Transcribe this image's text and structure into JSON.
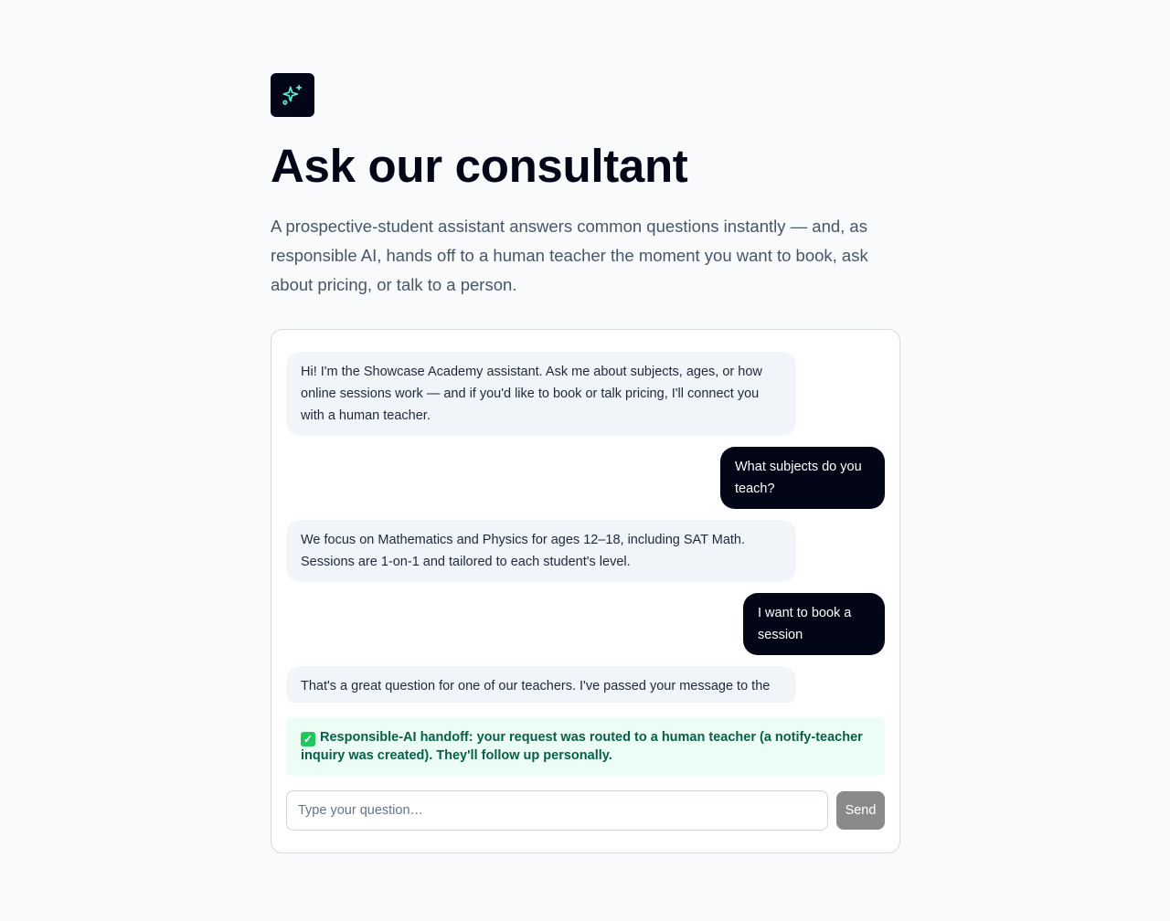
{
  "header": {
    "logo_icon": "sparkles-icon",
    "title": "Ask our consultant",
    "subtitle": "A prospective-student assistant answers common questions instantly — and, as responsible AI, hands off to a human teacher the moment you want to book, ask about pricing, or talk to a person."
  },
  "chat": {
    "messages": [
      {
        "role": "assistant",
        "text": "Hi! I'm the Showcase Academy assistant. Ask me about subjects, ages, or how online sessions work — and if you'd like to book or talk pricing, I'll connect you with a human teacher."
      },
      {
        "role": "user",
        "text": "What subjects do you teach?"
      },
      {
        "role": "assistant",
        "text": "We focus on Mathematics and Physics for ages 12–18, including SAT Math. Sessions are 1-on-1 and tailored to each student's level."
      },
      {
        "role": "user",
        "text": "I want to book a session"
      },
      {
        "role": "assistant",
        "text": "That's a great question for one of our teachers. I've passed your message to the"
      }
    ],
    "handoff": {
      "icon": "check-icon",
      "icon_glyph": "✓",
      "text": "Responsible-AI handoff: your request was routed to a human teacher (a notify-teacher inquiry was created). They'll follow up personally."
    },
    "composer": {
      "placeholder": "Type your question…",
      "value": "",
      "send_label": "Send"
    }
  },
  "colors": {
    "background": "#f8fafc",
    "user_bubble": "#020617",
    "assistant_bubble": "#f1f5f9",
    "handoff_bg": "#ecfdf5",
    "handoff_text": "#065f46",
    "logo_icon": "#5eead4",
    "send_disabled": "#8a8a8a"
  }
}
